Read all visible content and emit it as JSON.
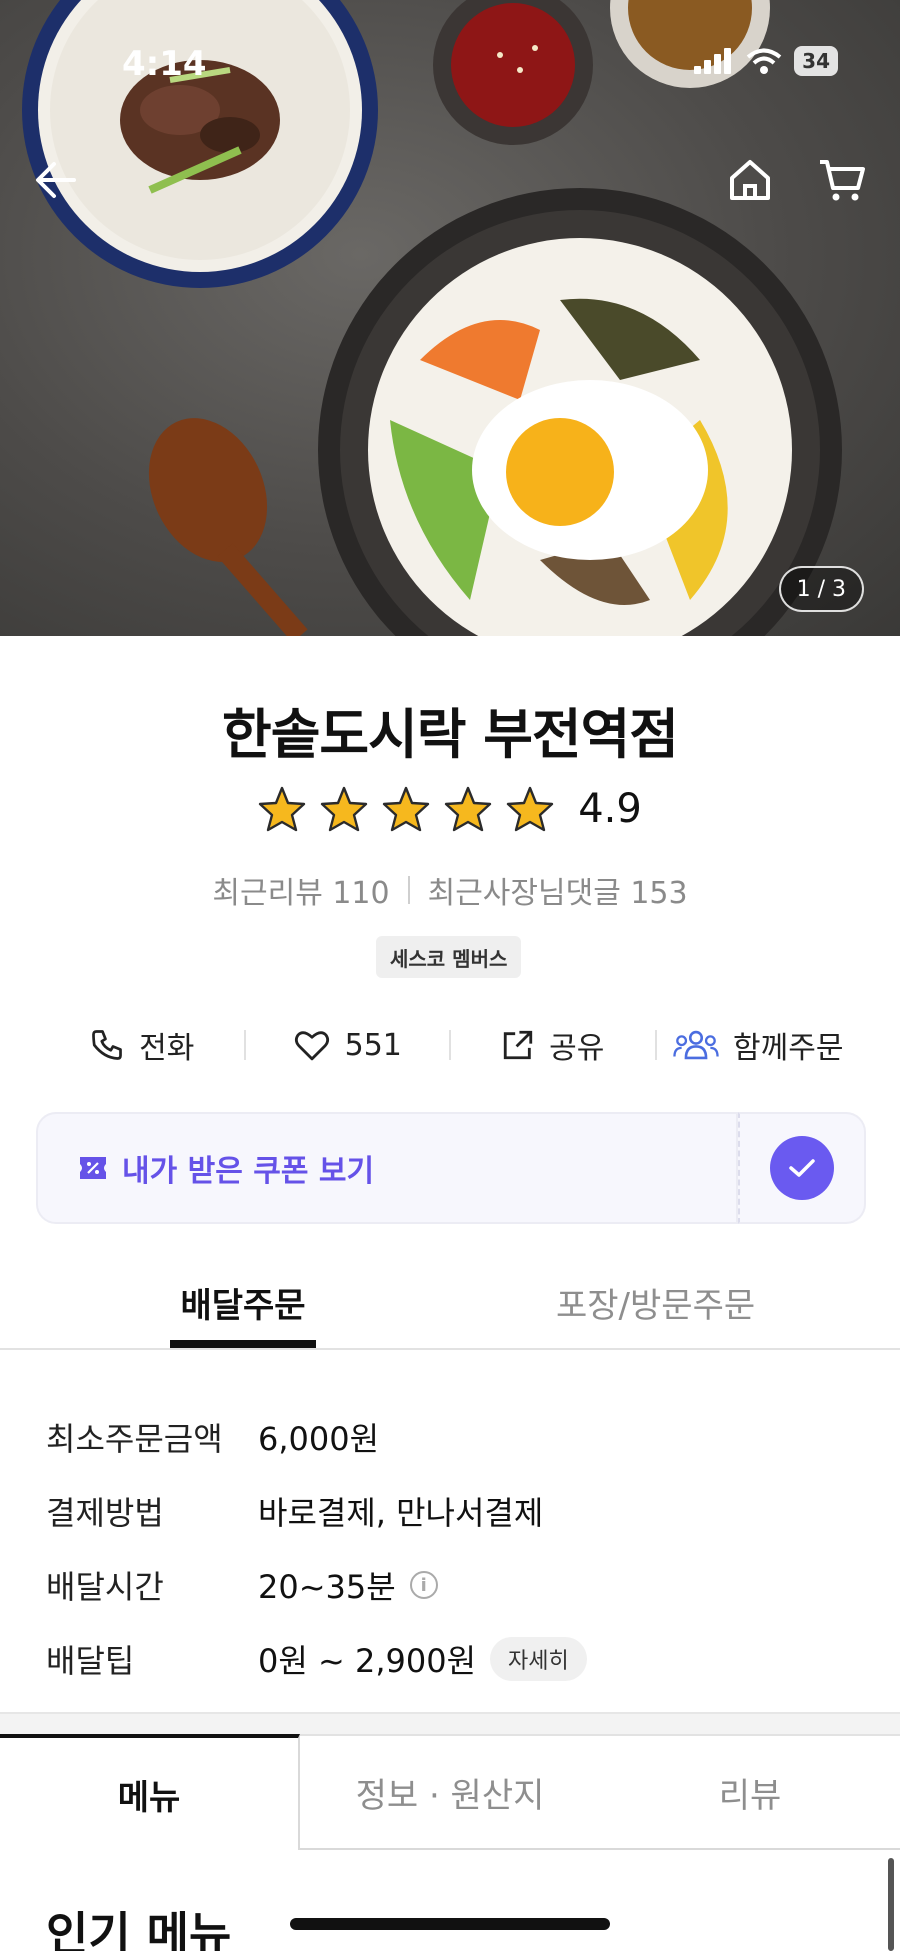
{
  "status_bar": {
    "time": "4:14",
    "battery": "34"
  },
  "hero": {
    "page_indicator": "1 / 3"
  },
  "store": {
    "name": "한솥도시락 부전역점",
    "rating": "4.9",
    "rating_value": 4.9,
    "recent_reviews": "최근리뷰 110",
    "owner_replies": "최근사장님댓글 153",
    "badge": "세스코 멤버스"
  },
  "actions": {
    "call": "전화",
    "likes": "551",
    "share": "공유",
    "group_order": "함께주문"
  },
  "coupon": {
    "label": "내가 받은 쿠폰 보기"
  },
  "order_tabs": {
    "delivery": "배달주문",
    "pickup": "포장/방문주문"
  },
  "info": {
    "rows": [
      {
        "label": "최소주문금액",
        "value": "6,000원"
      },
      {
        "label": "결제방법",
        "value": "바로결제, 만나서결제"
      },
      {
        "label": "배달시간",
        "value": "20~35분"
      },
      {
        "label": "배달팁",
        "value": "0원 ~ 2,900원"
      }
    ],
    "detail_button": "자세히"
  },
  "bottom_tabs": {
    "menu": "메뉴",
    "info_origin": "정보 · 원산지",
    "review": "리뷰"
  },
  "section": {
    "title": "인기 메뉴"
  },
  "colors": {
    "accent": "#6a5af0",
    "star": "#f6b81e"
  }
}
